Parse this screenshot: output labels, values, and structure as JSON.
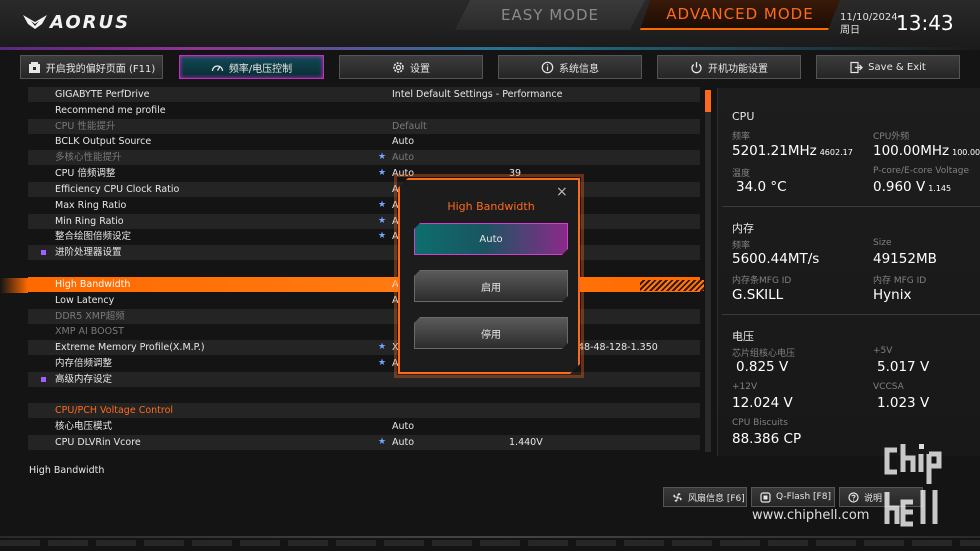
{
  "header": {
    "logo": "AORUS",
    "mode_easy": "EASY MODE",
    "mode_advanced": "ADVANCED MODE",
    "date": "11/10/2024",
    "weekday": "周日",
    "time": "13:43",
    "accent_color": "#ff6a1a"
  },
  "tabs": [
    {
      "label": "开启我的偏好页面 (F11)",
      "icon": "favorites-page-icon"
    },
    {
      "label": "频率/电压控制",
      "icon": "speedometer-icon",
      "active": true
    },
    {
      "label": "设置",
      "icon": "gear-icon"
    },
    {
      "label": "系统信息",
      "icon": "info-icon"
    },
    {
      "label": "开机功能设置",
      "icon": "power-icon"
    },
    {
      "label": "Save & Exit",
      "icon": "exit-icon"
    }
  ],
  "settings": [
    {
      "label": "GIGABYTE PerfDrive",
      "value": "Intel Default Settings - Performance"
    },
    {
      "label": "Recommend me profile",
      "value": ""
    },
    {
      "label": "CPU 性能提升",
      "value": "Default"
    },
    {
      "label": "BCLK Output Source",
      "value": "Auto"
    },
    {
      "label": "多核心性能提升",
      "value": "Auto"
    },
    {
      "label": "CPU 倍频调整",
      "value": "Auto",
      "value2": "39"
    },
    {
      "label": "Efficiency CPU Clock Ratio",
      "value": "A"
    },
    {
      "label": "Max Ring Ratio",
      "value": "A"
    },
    {
      "label": "Min Ring Ratio",
      "value": "A"
    },
    {
      "label": "整合绘图倍频设定",
      "value": "A"
    },
    {
      "label": "进阶处理器设置",
      "value": ""
    },
    {
      "label": "",
      "value": ""
    },
    {
      "label": "High Bandwidth",
      "value": "A"
    },
    {
      "label": "Low Latency",
      "value": "A"
    },
    {
      "label": "DDR5 XMP超频",
      "value": ""
    },
    {
      "label": "XMP AI BOOST",
      "value": ""
    },
    {
      "label": "Extreme Memory Profile(X.M.P.)",
      "value": "X",
      "value2": "48-48-128-1.350"
    },
    {
      "label": "内存倍频调整",
      "value": "Au"
    },
    {
      "label": "高级内存设定",
      "value": ""
    },
    {
      "label": "",
      "value": ""
    },
    {
      "label": "CPU/PCH Voltage Control",
      "value": ""
    },
    {
      "label": "核心电压模式",
      "value": "Auto"
    },
    {
      "label": "CPU DLVRin Vcore",
      "value": "Auto",
      "value2": "1.440V"
    }
  ],
  "info": {
    "cpu_title": "CPU",
    "freq_label": "频率",
    "freq_value": "5201.21MHz",
    "freq_sub": "4602.17",
    "ext_label": "CPU外频",
    "ext_value": "100.00MHz",
    "ext_sub": "100.00",
    "temp_label": "温度",
    "temp_value": "34.0 °C",
    "pcore_label": "P-core/E-core Voltage",
    "pcore_value": "0.960 V",
    "pcore_sub": "1.145",
    "mem_title": "内存",
    "mem_freq_label": "频率",
    "mem_freq_value": "5600.44MT/s",
    "size_label": "Size",
    "size_value": "49152MB",
    "mfg_label": "内存条MFG ID",
    "mfg_value": "G.SKILL",
    "mfg2_label": "内存 MFG ID",
    "mfg2_value": "Hynix",
    "volt_title": "电压",
    "chipset_label": "芯片组核心电压",
    "chipset_value": "0.825 V",
    "p5_label": "+5V",
    "p5_value": "5.017 V",
    "p12_label": "+12V",
    "p12_value": "12.024 V",
    "vccsa_label": "VCCSA",
    "vccsa_value": "1.023 V",
    "biscuits_label": "CPU Biscuits",
    "biscuits_value": "88.386 CP"
  },
  "modal": {
    "title": "High Bandwidth",
    "close": "×",
    "options": [
      "Auto",
      "启用",
      "停用"
    ],
    "selected": "Auto"
  },
  "help_text": "High Bandwidth",
  "bottom_buttons": [
    {
      "label": "风扇信息 [F6]",
      "icon": "fan-icon"
    },
    {
      "label": "Q-Flash [F8]",
      "icon": "qflash-icon"
    },
    {
      "label": "说明",
      "icon": "help-icon"
    }
  ],
  "watermark": {
    "url": "www.chiphell.com",
    "logo": "chip hell"
  }
}
